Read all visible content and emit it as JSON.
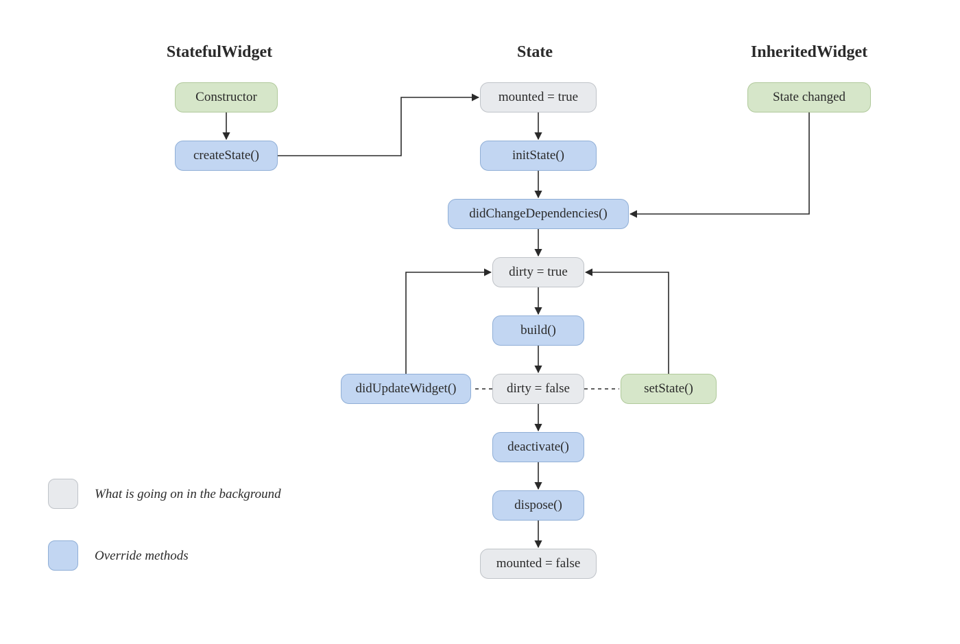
{
  "headings": {
    "stateful_widget": "StatefulWidget",
    "state": "State",
    "inherited_widget": "InheritedWidget"
  },
  "nodes": {
    "constructor": "Constructor",
    "create_state": "createState()",
    "mounted_true": "mounted = true",
    "init_state": "initState()",
    "did_change_dependencies": "didChangeDependencies()",
    "dirty_true": "dirty = true",
    "build": "build()",
    "dirty_false": "dirty = false",
    "did_update_widget": "didUpdateWidget()",
    "set_state": "setState()",
    "deactivate": "deactivate()",
    "dispose": "dispose()",
    "mounted_false": "mounted = false",
    "state_changed": "State changed"
  },
  "legend": {
    "background_label": "What is going on in the background",
    "override_label": "Override methods"
  },
  "colors": {
    "grey_fill": "#e8eaed",
    "grey_stroke": "#bfc3c8",
    "blue_fill": "#c2d6f2",
    "blue_stroke": "#8faed6",
    "green_fill": "#d6e6c9",
    "green_stroke": "#b0c99b",
    "line": "#2a2a2a"
  },
  "chart_data": {
    "type": "flowchart",
    "columns": [
      {
        "title": "StatefulWidget",
        "nodes": [
          "constructor",
          "create_state"
        ]
      },
      {
        "title": "State",
        "nodes": [
          "mounted_true",
          "init_state",
          "did_change_dependencies",
          "dirty_true",
          "build",
          "dirty_false",
          "deactivate",
          "dispose",
          "mounted_false"
        ]
      },
      {
        "title": "InheritedWidget",
        "nodes": [
          "state_changed"
        ]
      }
    ],
    "side_nodes": [
      "did_update_widget",
      "set_state"
    ],
    "node_styles": {
      "grey": [
        "mounted_true",
        "dirty_true",
        "dirty_false",
        "mounted_false"
      ],
      "blue": [
        "create_state",
        "init_state",
        "did_change_dependencies",
        "build",
        "did_update_widget",
        "deactivate",
        "dispose"
      ],
      "green": [
        "constructor",
        "state_changed",
        "set_state"
      ]
    },
    "edges": [
      {
        "from": "constructor",
        "to": "create_state",
        "style": "solid"
      },
      {
        "from": "create_state",
        "to": "mounted_true",
        "style": "solid"
      },
      {
        "from": "mounted_true",
        "to": "init_state",
        "style": "solid"
      },
      {
        "from": "init_state",
        "to": "did_change_dependencies",
        "style": "solid"
      },
      {
        "from": "did_change_dependencies",
        "to": "dirty_true",
        "style": "solid"
      },
      {
        "from": "dirty_true",
        "to": "build",
        "style": "solid"
      },
      {
        "from": "build",
        "to": "dirty_false",
        "style": "solid"
      },
      {
        "from": "dirty_false",
        "to": "did_update_widget",
        "style": "dashed"
      },
      {
        "from": "did_update_widget",
        "to": "dirty_true",
        "style": "solid"
      },
      {
        "from": "dirty_false",
        "to": "set_state",
        "style": "dashed"
      },
      {
        "from": "set_state",
        "to": "dirty_true",
        "style": "solid"
      },
      {
        "from": "dirty_false",
        "to": "deactivate",
        "style": "solid"
      },
      {
        "from": "deactivate",
        "to": "dispose",
        "style": "solid"
      },
      {
        "from": "dispose",
        "to": "mounted_false",
        "style": "solid"
      },
      {
        "from": "state_changed",
        "to": "did_change_dependencies",
        "style": "solid"
      }
    ],
    "legend": [
      {
        "style": "grey",
        "label": "What is going on in the background"
      },
      {
        "style": "blue",
        "label": "Override methods"
      }
    ]
  }
}
